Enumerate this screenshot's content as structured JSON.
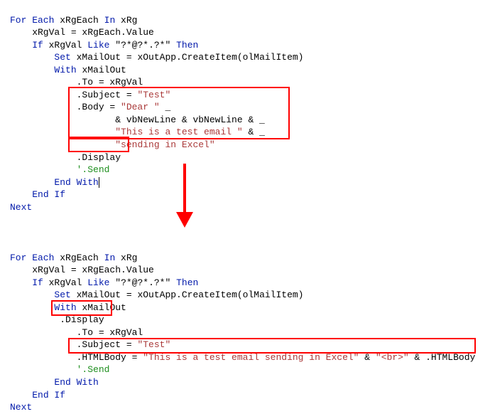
{
  "top": {
    "l0": "For Each",
    "l0b": " xRgEach ",
    "l0c": "In",
    "l0d": " xRg",
    "l1": "    xRgVal = xRgEach.Value",
    "l2a": "    ",
    "l2b": "If",
    "l2c": " xRgVal ",
    "l2d": "Like",
    "l2e": " \"?*@?*.?*\" ",
    "l2f": "Then",
    "l3": "        ",
    "l3a": "Set",
    "l3b": " xMailOut = xOutApp.CreateItem(olMailItem)",
    "l4": "        ",
    "l4a": "With",
    "l4b": " xMailOut",
    "l5": "            .To = xRgVal",
    "l6a": "            .Subject = ",
    "l6b": "\"Test\"",
    "l7a": "            .Body = ",
    "l7b": "\"Dear \"",
    "l7c": " _",
    "l8a": "                   & vbNewLine & vbNewLine & _",
    "l9a": "                   ",
    "l9b": "\"This is a test email \"",
    "l9c": " & _",
    "l10a": "                   ",
    "l10b": "\"sending in Excel\"",
    "l11": "            .Display",
    "l12a": "            ",
    "l12b": "'.Send",
    "l13": "        ",
    "l13a": "End With",
    "l14": "    ",
    "l14a": "End If",
    "l15": "Next"
  },
  "bottom": {
    "l0": "For Each",
    "l0b": " xRgEach ",
    "l0c": "In",
    "l0d": " xRg",
    "l1": "    xRgVal = xRgEach.Value",
    "l2a": "    ",
    "l2b": "If",
    "l2c": " xRgVal ",
    "l2d": "Like",
    "l2e": " \"?*@?*.?*\" ",
    "l2f": "Then",
    "l3": "        ",
    "l3a": "Set",
    "l3b": " xMailOut = xOutApp.CreateItem(olMailItem)",
    "l4": "        ",
    "l4a": "With",
    "l4b": " xMailOut",
    "l5": "         .Display",
    "l6": "            .To = xRgVal",
    "l7a": "            .Subject = ",
    "l7b": "\"Test\"",
    "l8a": "            .HTMLBody = ",
    "l8b": "\"This is a test email sending in Excel\"",
    "l8c": " & ",
    "l8d": "\"<br>\"",
    "l8e": " & .HTMLBody",
    "l9a": "            ",
    "l9b": "'.Send",
    "l10": "        ",
    "l10a": "End With",
    "l11": "    ",
    "l11a": "End If",
    "l12": "Next"
  }
}
